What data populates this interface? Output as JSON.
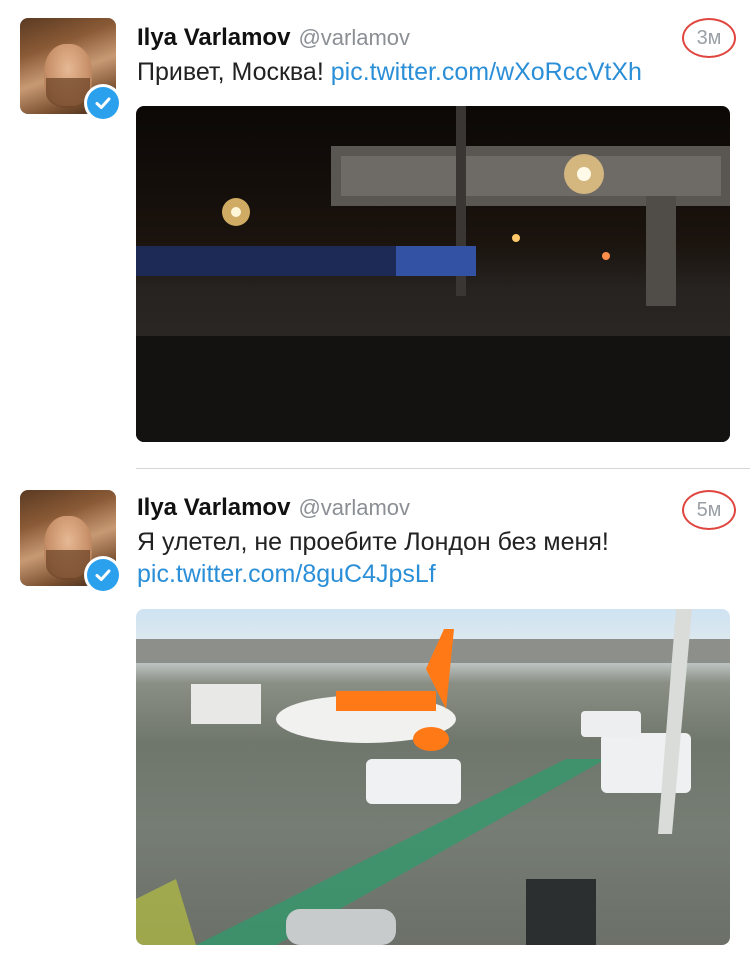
{
  "tweets": [
    {
      "author": "Ilya Varlamov",
      "handle": "@varlamov",
      "time": "3м",
      "text": "Привет, Москва!",
      "link": "pic.twitter.com/wXoRccVtXh"
    },
    {
      "author": "Ilya Varlamov",
      "handle": "@varlamov",
      "time": "5м",
      "text": "Я улетел, не проебите Лондон без меня!",
      "link": "pic.twitter.com/8guC4JpsLf"
    }
  ],
  "colors": {
    "link": "#2b8fd8",
    "verified": "#2ba1ed",
    "highlight": "#e0463f"
  },
  "icons": [
    "verified-badge-icon"
  ]
}
